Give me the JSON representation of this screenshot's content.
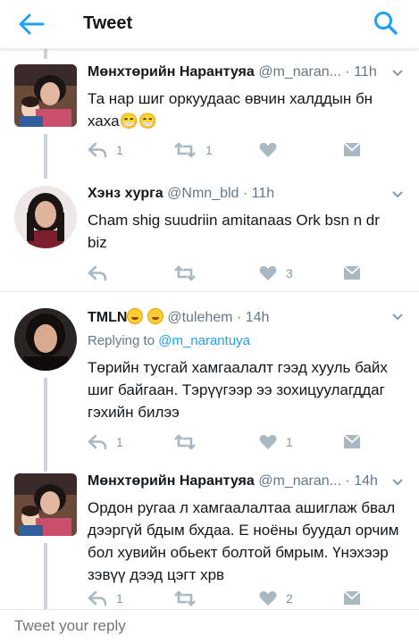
{
  "header": {
    "title": "Tweet",
    "back_icon": "arrow-left-icon",
    "search_icon": "search-icon",
    "accent": "#1da1f2"
  },
  "tweets": [
    {
      "name": "Мөнхтөрийн Нарантуяа",
      "handle": "@m_naran...",
      "time": "11h",
      "text": "Та нар шиг оркуудаас өвчин халддын бн хаха😁😁",
      "replies": "1",
      "retweets": "1",
      "likes": ""
    },
    {
      "name": "Хэнз хурга",
      "handle": "@Nmn_bld",
      "time": "11h",
      "text": "Cham shig suudriin amitanaas  Ork bsn n dr biz",
      "replies": "",
      "retweets": "",
      "likes": "3"
    },
    {
      "name": "TMLN",
      "name_emoji": "😅☺",
      "handle": "@tulehem",
      "time": "14h",
      "replying_prefix": "Replying to",
      "replying_to": "@m_narantuya",
      "text": "Төрийн тусгай хамгаалалт гээд хууль байх шиг байгаан. Тэрүүгээр ээ зохицуулагддаг гэхийн билээ",
      "replies": "1",
      "retweets": "",
      "likes": "1"
    },
    {
      "name": "Мөнхтөрийн Нарантуяа",
      "handle": "@m_naran...",
      "time": "14h",
      "text": "Ордон ругаа л хамгаалалтаа ашиглаж бвал дээргүй бдым бхдаа. Е ноёны буудал орчим бол хувийн обьект болтой бмрым. Үнэхээр зэвүү дээд цэгт хрв",
      "replies": "1",
      "retweets": "",
      "likes": "2"
    }
  ],
  "reply": {
    "placeholder": "Tweet your reply"
  }
}
